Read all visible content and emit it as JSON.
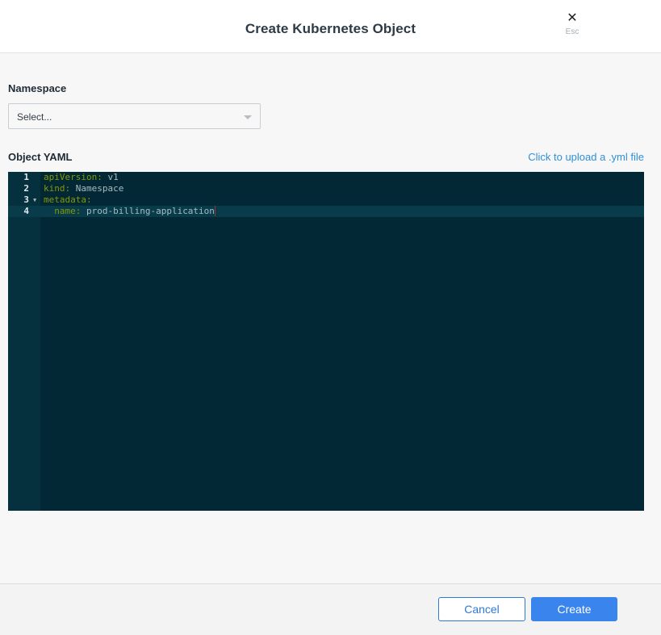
{
  "header": {
    "title": "Create Kubernetes Object",
    "close_icon": "close-icon",
    "close_glyph": "✕",
    "close_hint": "Esc"
  },
  "namespace": {
    "label": "Namespace",
    "selected_value": "Select...",
    "dropdown_icon": "chevron-down-icon"
  },
  "yaml": {
    "label": "Object YAML",
    "upload_link": "Click to upload a .yml file",
    "lines": [
      {
        "number": "1",
        "key": "apiVersion:",
        "value": " v1"
      },
      {
        "number": "2",
        "key": "kind:",
        "value": " Namespace"
      },
      {
        "number": "3",
        "key": "metadata:",
        "value": ""
      },
      {
        "number": "4",
        "key": "  name:",
        "value": " prod-billing-application"
      }
    ],
    "active_line": 4,
    "foldable_line": 3
  },
  "footer": {
    "cancel_label": "Cancel",
    "create_label": "Create"
  },
  "colors": {
    "accent": "#3a84ee",
    "link": "#2f8fd8",
    "editor_bg": "#032835",
    "yaml_key": "#859900"
  }
}
